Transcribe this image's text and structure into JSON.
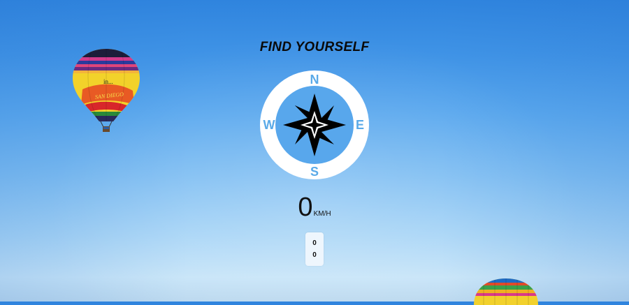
{
  "header": {
    "title": "FIND YOURSELF"
  },
  "compass": {
    "labels": {
      "north": "N",
      "east": "E",
      "south": "S",
      "west": "W"
    },
    "ring_color": "#ffffff",
    "label_color": "#5aaae8",
    "star_color": "#000000"
  },
  "speed": {
    "value": "0",
    "unit": "KM/H"
  },
  "coordinates": {
    "first": "0",
    "second": "0"
  },
  "background": {
    "balloon_1_text_top": "in...",
    "balloon_1_text_main": "SAN DIEGO"
  }
}
